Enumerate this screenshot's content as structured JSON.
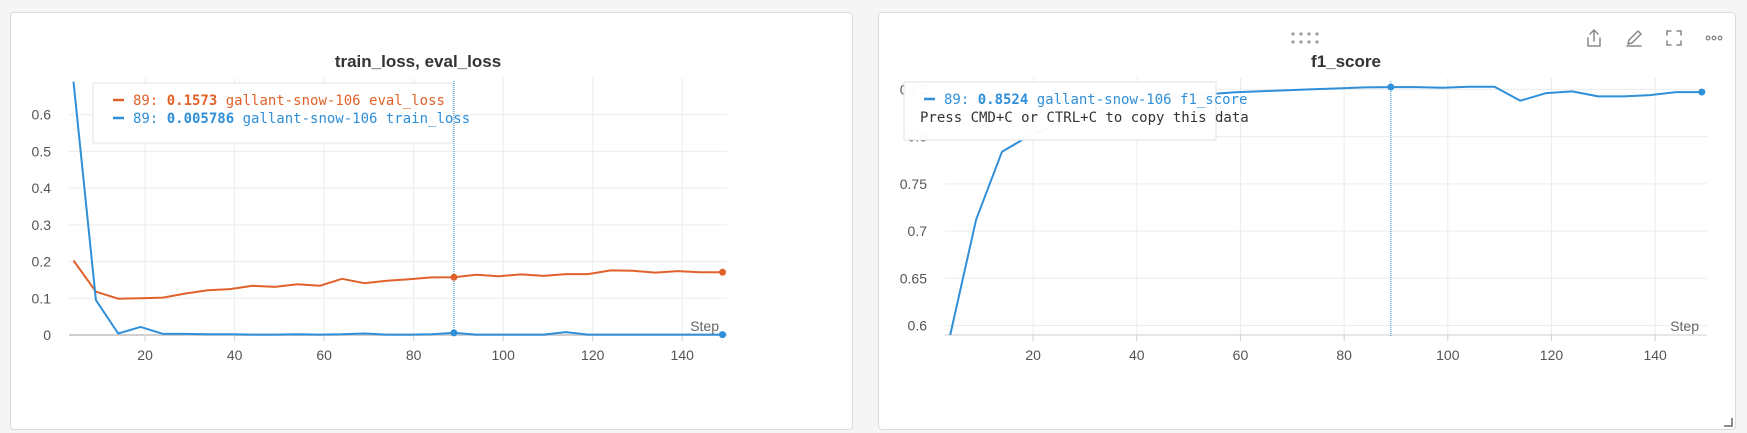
{
  "colors": {
    "eval": "#e0622a",
    "train": "#2f8fd8",
    "f1": "#2f8fd8",
    "grid": "#ececec",
    "axis": "#cfcfcf"
  },
  "toolbar": {
    "icons": [
      "share-icon",
      "edit-icon",
      "fullscreen-icon",
      "more-icon"
    ]
  },
  "chart_data": [
    {
      "type": "line",
      "title": "train_loss, eval_loss",
      "xlabel": "Step",
      "ylabel": "",
      "xlim": [
        3,
        150
      ],
      "ylim": [
        0,
        0.7
      ],
      "xticks": [
        20,
        40,
        60,
        80,
        100,
        120,
        140
      ],
      "yticks": [
        0,
        0.1,
        0.2,
        0.3,
        0.4,
        0.5,
        0.6
      ],
      "grid": true,
      "series": [
        {
          "name": "gallant-snow-106 eval_loss",
          "x": [
            4,
            9,
            14,
            19,
            24,
            29,
            34,
            39,
            44,
            49,
            54,
            59,
            64,
            69,
            74,
            79,
            84,
            89,
            94,
            99,
            104,
            109,
            114,
            119,
            124,
            129,
            134,
            139,
            144,
            149
          ],
          "y": [
            0.203,
            0.118,
            0.099,
            0.1,
            0.102,
            0.113,
            0.122,
            0.125,
            0.134,
            0.131,
            0.138,
            0.134,
            0.153,
            0.141,
            0.148,
            0.152,
            0.157,
            0.1573,
            0.164,
            0.16,
            0.165,
            0.161,
            0.166,
            0.166,
            0.176,
            0.175,
            0.17,
            0.174,
            0.171,
            0.171
          ]
        },
        {
          "name": "gallant-snow-106 train_loss",
          "x": [
            4,
            9,
            14,
            19,
            24,
            29,
            34,
            39,
            44,
            49,
            54,
            59,
            64,
            69,
            74,
            79,
            84,
            89,
            94,
            99,
            104,
            109,
            114,
            119,
            124,
            129,
            134,
            139,
            144,
            149
          ],
          "y": [
            0.69,
            0.095,
            0.004,
            0.022,
            0.003,
            0.003,
            0.002,
            0.002,
            0.001,
            0.001,
            0.002,
            0.001,
            0.002,
            0.004,
            0.001,
            0.001,
            0.002,
            0.005786,
            0.001,
            0.001,
            0.001,
            0.001,
            0.008,
            0.001,
            0.001,
            0.001,
            0.001,
            0.001,
            0.001,
            0.001
          ]
        }
      ],
      "tooltip": {
        "entries": [
          {
            "step": "89: ",
            "value": "0.1573",
            "label": "gallant-snow-106 eval_loss"
          },
          {
            "step": "89: ",
            "value": "0.005786",
            "label": "gallant-snow-106 train_loss"
          }
        ],
        "hover_step": 89
      }
    },
    {
      "type": "line",
      "title": "f1_score",
      "xlabel": "Step",
      "ylabel": "",
      "xlim": [
        3,
        150
      ],
      "ylim": [
        0.59,
        0.862
      ],
      "xticks": [
        20,
        40,
        60,
        80,
        100,
        120,
        140
      ],
      "yticks": [
        0.6,
        0.65,
        0.7,
        0.75,
        0.8,
        0.85
      ],
      "yticklabels": [
        "0.6",
        "0.65",
        "0.7",
        "0.75",
        "0.8",
        "0.85"
      ],
      "grid": true,
      "series": [
        {
          "name": "gallant-snow-106 f1_score",
          "x": [
            4,
            9,
            14,
            19,
            24,
            29,
            34,
            39,
            44,
            49,
            54,
            59,
            64,
            69,
            74,
            79,
            84,
            89,
            94,
            99,
            104,
            109,
            114,
            119,
            124,
            129,
            134,
            139,
            144,
            149
          ],
          "y": [
            0.59,
            0.712,
            0.784,
            0.8,
            0.812,
            0.822,
            0.83,
            0.836,
            0.84,
            0.843,
            0.845,
            0.847,
            0.848,
            0.849,
            0.85,
            0.851,
            0.852,
            0.8524,
            0.8524,
            0.8516,
            0.8527,
            0.8527,
            0.838,
            0.846,
            0.8478,
            0.8425,
            0.8425,
            0.8439,
            0.8471,
            0.8471
          ]
        }
      ],
      "tooltip": {
        "entries": [
          {
            "step": "89: ",
            "value": "0.8524",
            "label": "gallant-snow-106 f1_score"
          }
        ],
        "hint": "Press CMD+C or CTRL+C to copy this data",
        "hover_step": 89
      }
    }
  ]
}
